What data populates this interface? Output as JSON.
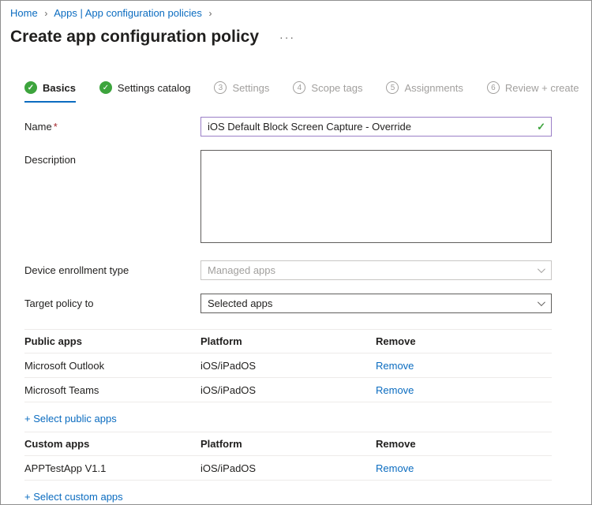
{
  "icons": {
    "check": "✓",
    "ellipsis": "···"
  },
  "breadcrumb": {
    "separator": "›",
    "items": [
      {
        "label": "Home"
      },
      {
        "label": "Apps | App configuration policies"
      }
    ]
  },
  "header": {
    "title": "Create app configuration policy"
  },
  "wizard": {
    "steps": [
      {
        "label": "Basics",
        "state": "complete-active"
      },
      {
        "label": "Settings catalog",
        "state": "complete"
      },
      {
        "label": "Settings",
        "number": "3",
        "state": "disabled"
      },
      {
        "label": "Scope tags",
        "number": "4",
        "state": "disabled"
      },
      {
        "label": "Assignments",
        "number": "5",
        "state": "disabled"
      },
      {
        "label": "Review + create",
        "number": "6",
        "state": "disabled"
      }
    ]
  },
  "form": {
    "name": {
      "label": "Name",
      "required_marker": "*",
      "value": "iOS Default Block Screen Capture - Override"
    },
    "description": {
      "label": "Description",
      "value": ""
    },
    "device_enrollment": {
      "label": "Device enrollment type",
      "value": "Managed apps",
      "disabled": true
    },
    "target_policy": {
      "label": "Target policy to",
      "value": "Selected apps"
    }
  },
  "public_apps": {
    "headers": {
      "name": "Public apps",
      "platform": "Platform",
      "remove": "Remove"
    },
    "rows": [
      {
        "name": "Microsoft Outlook",
        "platform": "iOS/iPadOS",
        "remove": "Remove"
      },
      {
        "name": "Microsoft Teams",
        "platform": "iOS/iPadOS",
        "remove": "Remove"
      }
    ],
    "add_link": "+ Select public apps"
  },
  "custom_apps": {
    "headers": {
      "name": "Custom apps",
      "platform": "Platform",
      "remove": "Remove"
    },
    "rows": [
      {
        "name": "APPTestApp V1.1",
        "platform": "iOS/iPadOS",
        "remove": "Remove"
      }
    ],
    "add_link": "+ Select custom apps"
  },
  "colors": {
    "accent_blue": "#0b6cc0",
    "success_green": "#3da43d",
    "disabled_gray": "#a19f9d",
    "name_border_purple": "#9b7fc7",
    "required_red": "#a4262c"
  }
}
